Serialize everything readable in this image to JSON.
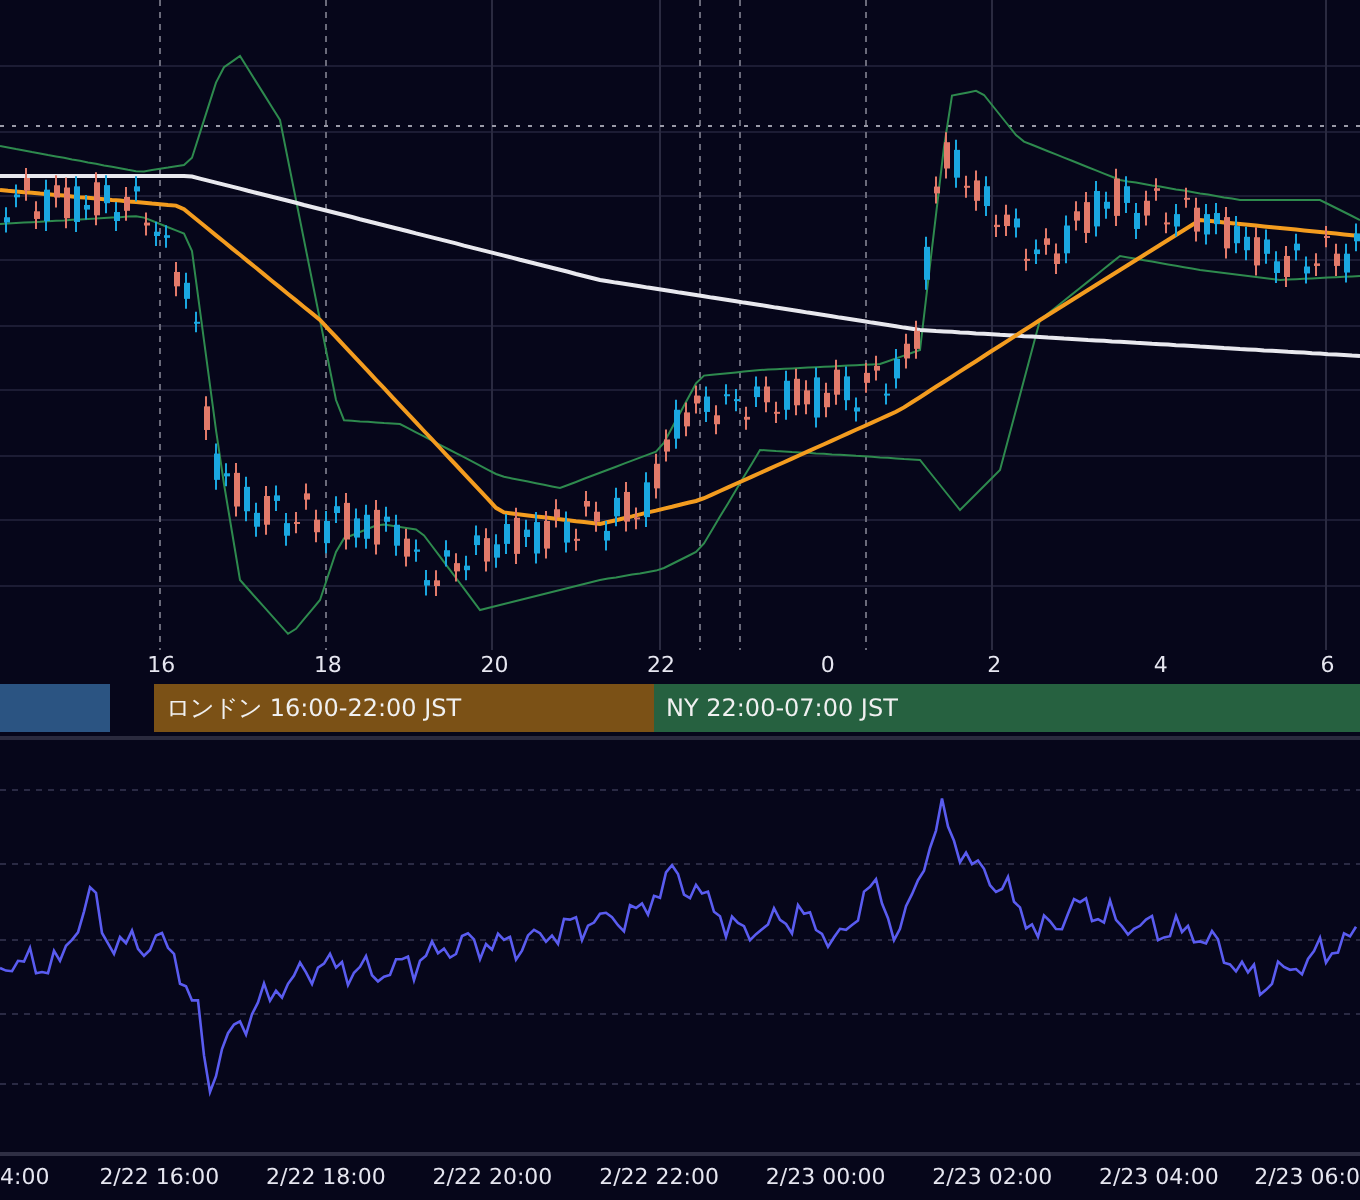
{
  "price_chart": {
    "time_labels": [
      "16",
      "18",
      "20",
      "22",
      "0",
      "2",
      "4",
      "6"
    ]
  },
  "sessions": [
    {
      "color": "#2b5482"
    },
    {
      "label": "ロンドン 16:00-22:00 JST",
      "color": "#7b5116"
    },
    {
      "label": "NY 22:00-07:00 JST",
      "color": "#266140"
    }
  ],
  "indicator_chart": {
    "time_labels": [
      "4:00",
      "2/22 16:00",
      "2/22 18:00",
      "2/22 20:00",
      "2/22 22:00",
      "2/23 00:00",
      "2/23 02:00",
      "2/23 04:00",
      "2/23 06:0"
    ]
  }
}
